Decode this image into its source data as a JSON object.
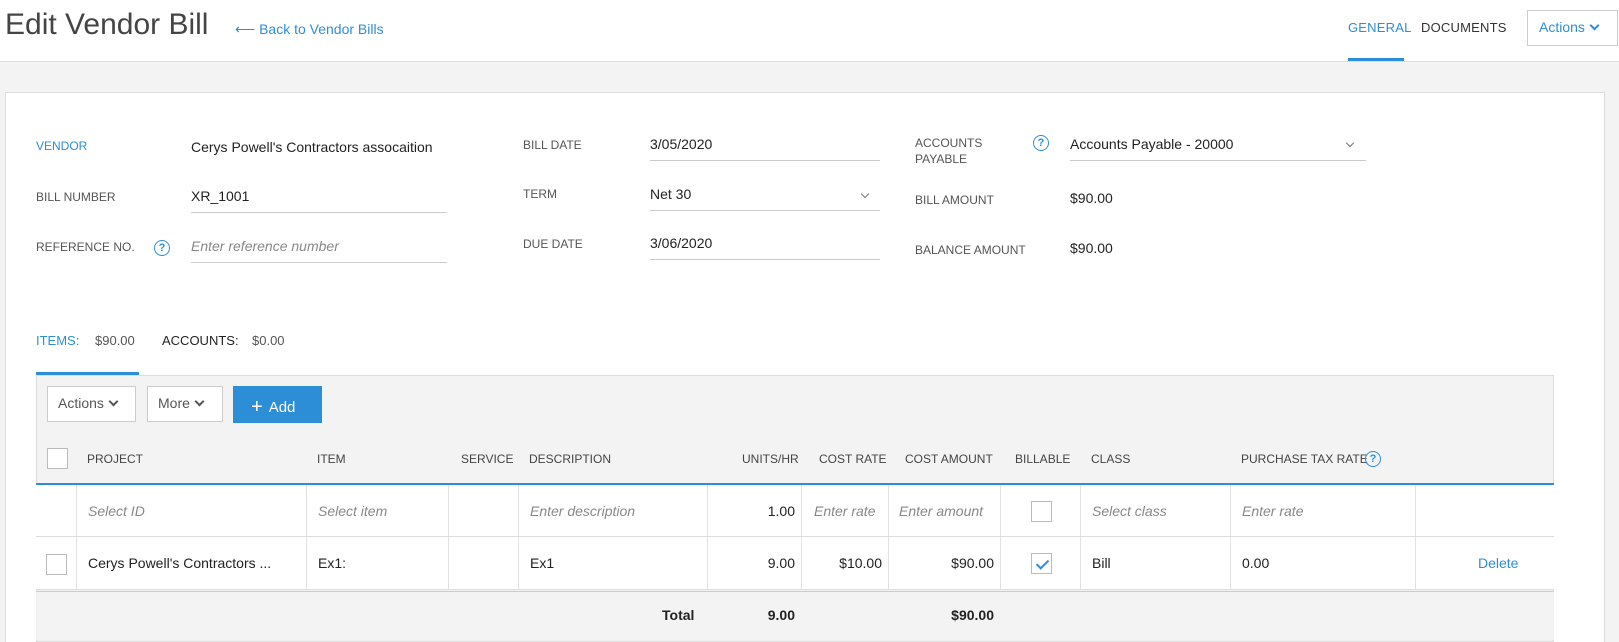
{
  "header": {
    "title": "Edit Vendor Bill",
    "back_link": "Back to Vendor Bills",
    "tabs": [
      "GENERAL",
      "DOCUMENTS"
    ],
    "actions_label": "Actions",
    "accent": "#2d8ed8"
  },
  "form": {
    "vendor_label": "VENDOR",
    "vendor_value": "Cerys Powell's Contractors assocaition",
    "bill_number_label": "BILL NUMBER",
    "bill_number_value": "XR_1001",
    "reference_label": "REFERENCE NO.",
    "reference_placeholder": "Enter reference number",
    "bill_date_label": "BILL DATE",
    "bill_date_value": "3/05/2020",
    "term_label": "TERM",
    "term_value": "Net 30",
    "due_date_label": "DUE DATE",
    "due_date_value": "3/06/2020",
    "ap_label_1": "ACCOUNTS",
    "ap_label_2": "PAYABLE",
    "ap_value": "Accounts Payable - 20000",
    "bill_amount_label": "BILL AMOUNT",
    "bill_amount_value": "$90.00",
    "balance_label": "BALANCE AMOUNT",
    "balance_value": "$90.00"
  },
  "subtabs": {
    "items_label": "ITEMS:",
    "items_value": "$90.00",
    "accounts_label": "ACCOUNTS:",
    "accounts_value": "$0.00"
  },
  "toolbar": {
    "actions": "Actions",
    "more": "More",
    "add": "Add"
  },
  "table": {
    "headers": {
      "project": "PROJECT",
      "item": "ITEM",
      "service": "SERVICE",
      "description": "DESCRIPTION",
      "units": "UNITS/HR",
      "cost_rate": "COST RATE",
      "cost_amount": "COST AMOUNT",
      "billable": "BILLABLE",
      "class": "CLASS",
      "tax_rate": "PURCHASE TAX RATE"
    },
    "new_row": {
      "project": "Select ID",
      "item": "Select item",
      "description": "Enter description",
      "units": "1.00",
      "cost_rate": "Enter rate",
      "cost_amount": "Enter amount",
      "class": "Select class",
      "tax_rate": "Enter rate"
    },
    "rows": [
      {
        "project": "Cerys Powell's Contractors ...",
        "item": "Ex1:",
        "description": "Ex1",
        "units": "9.00",
        "cost_rate": "$10.00",
        "cost_amount": "$90.00",
        "billable": true,
        "class": "Bill",
        "tax_rate": "0.00",
        "delete": "Delete"
      }
    ],
    "total": {
      "label": "Total",
      "units": "9.00",
      "cost_amount": "$90.00"
    }
  }
}
